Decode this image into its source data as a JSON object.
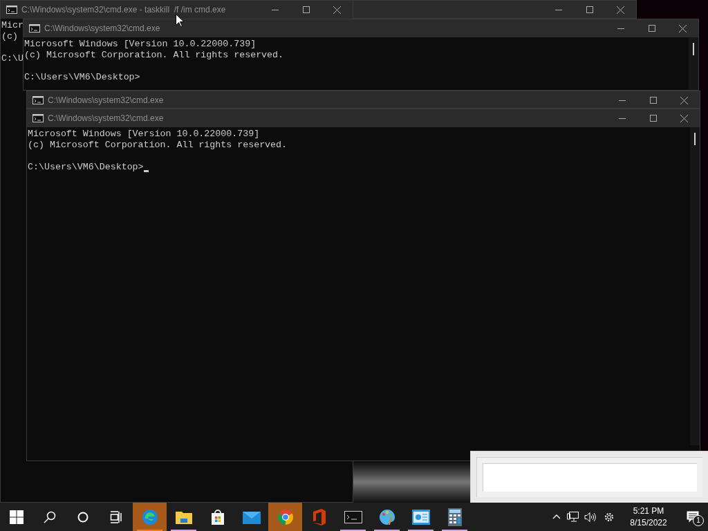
{
  "windows": [
    {
      "kind": "titlebar"
    },
    {
      "kind": "console",
      "title": "C:\\Windows\\system32\\cmd.exe - taskkill  /f /im cmd.exe",
      "lines": [
        "Micr",
        "(c)"
      ],
      "prompt": "C:\\U",
      "cursor": false
    },
    {
      "kind": "console",
      "title": "C:\\Windows\\system32\\cmd.exe",
      "lines": [
        "Microsoft Windows [Version 10.0.22000.739]",
        "(c) Microsoft Corporation. All rights reserved."
      ],
      "prompt": "C:\\Users\\VM6\\Desktop>",
      "cursor": false
    },
    {
      "kind": "titlebar",
      "title": "C:\\Windows\\system32\\cmd.exe"
    },
    {
      "kind": "console",
      "title": "C:\\Windows\\system32\\cmd.exe",
      "lines": [
        "Microsoft Windows [Version 10.0.22000.739]",
        "(c) Microsoft Corporation. All rights reserved."
      ],
      "prompt": "C:\\Users\\VM6\\Desktop>",
      "cursor": true
    }
  ],
  "taskbar": {
    "apps": [
      {
        "highlighted": true,
        "running": true
      },
      {
        "highlighted": false,
        "running": true
      },
      {
        "highlighted": false,
        "running": false
      },
      {
        "highlighted": false,
        "running": false
      },
      {
        "highlighted": true,
        "running": false
      },
      {
        "highlighted": false,
        "running": false
      },
      {
        "highlighted": false,
        "running": true
      },
      {
        "highlighted": false,
        "running": true
      },
      {
        "highlighted": false,
        "running": true
      },
      {
        "highlighted": false,
        "running": true
      }
    ],
    "time": "5:21 PM",
    "date": "8/15/2022",
    "notification_count": "1"
  }
}
